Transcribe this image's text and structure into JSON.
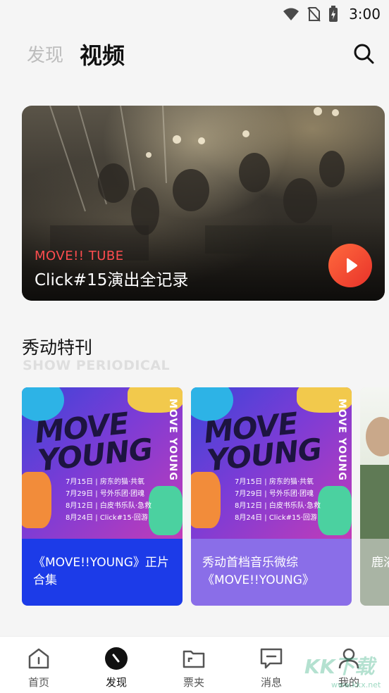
{
  "status_bar": {
    "time": "3:00",
    "icons": [
      "wifi-icon",
      "no-sim-icon",
      "battery-charging-icon"
    ]
  },
  "header": {
    "tabs": [
      {
        "label": "发现",
        "active": false
      },
      {
        "label": "视频",
        "active": true
      }
    ],
    "search_icon": "search-icon"
  },
  "hero": {
    "tag": "MOVE!! TUBE",
    "title": "Click#15演出全记录",
    "play_icon": "play-icon",
    "tag_color": "#ff4d4f",
    "play_color": "#e8322a"
  },
  "section": {
    "title": "秀动特刊",
    "subtitle": "SHOW PERIODICAL",
    "cards": [
      {
        "poster": {
          "logo": "MOVE YOUNG",
          "side_text": "MOVE YOUNG",
          "schedule": [
            "7月15日 | 房东的猫·共氧",
            "7月29日 | 号外乐团·团魂",
            "8月12日 | 白皮书乐队·急救",
            "8月24日 | Click#15·回游"
          ]
        },
        "caption": "《MOVE!!YOUNG》正片合集",
        "color": "#1c3be8"
      },
      {
        "poster": {
          "logo": "MOVE YOUNG",
          "side_text": "MOVE YOUNG",
          "schedule": [
            "7月15日 | 房东的猫·共氧",
            "7月29日 | 号外乐团·团魂",
            "8月12日 | 白皮书乐队·急救",
            "8月24日 | Click#15·回游"
          ]
        },
        "caption": "秀动首档音乐微综《MOVE!!YOUNG》",
        "color": "#8a6ee8"
      },
      {
        "caption": "鹿浴笑",
        "color": "#a9b4a4"
      }
    ]
  },
  "bottom_nav": [
    {
      "label": "首页",
      "icon": "home-icon",
      "active": false
    },
    {
      "label": "发现",
      "icon": "discover-icon",
      "active": true
    },
    {
      "label": "票夹",
      "icon": "ticket-folder-icon",
      "active": false
    },
    {
      "label": "消息",
      "icon": "message-icon",
      "active": false
    },
    {
      "label": "我的",
      "icon": "profile-icon",
      "active": false
    }
  ],
  "watermark": {
    "logo": "KK下载",
    "url": "www.kkx.net"
  }
}
